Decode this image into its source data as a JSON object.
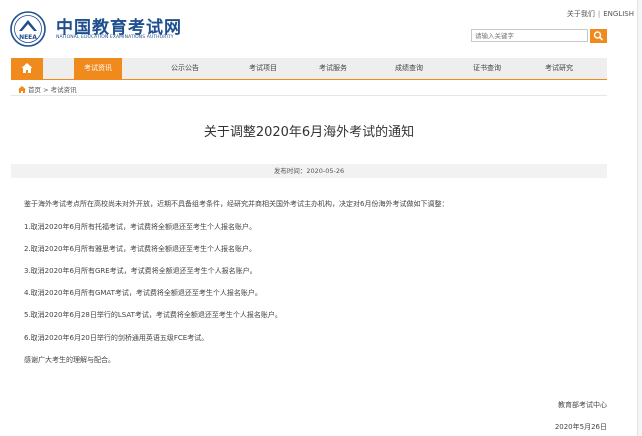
{
  "header": {
    "logo_title": "中国教育考试网",
    "logo_subtitle": "NATIONAL EDUCATION EXAMINATIONS AUTHORITY",
    "logo_mark_text": "NEEA",
    "top_links": [
      "关于我们",
      "ENGLISH"
    ],
    "top_link_separator": "|",
    "search_placeholder": "请输入关键字",
    "search_icon": "search-icon",
    "accent_color": "#f08a1d",
    "brand_color": "#1e4f8f"
  },
  "nav": {
    "home_icon": "home-icon",
    "items": [
      {
        "label": "考试资讯",
        "active": true
      },
      {
        "label": "公示公告",
        "active": false
      },
      {
        "label": "考试项目",
        "active": false
      },
      {
        "label": "考试服务",
        "active": false
      },
      {
        "label": "成绩查询",
        "active": false
      },
      {
        "label": "证书查询",
        "active": false
      },
      {
        "label": "考试研究",
        "active": false
      }
    ]
  },
  "breadcrumb": {
    "icon": "home-icon",
    "home": "首页",
    "separator": ">",
    "current": "考试资讯"
  },
  "article": {
    "title": "关于调整2020年6月海外考试的通知",
    "publish_label": "发布时间：",
    "publish_date": "2020-05-26",
    "paragraphs": [
      "鉴于海外考试考点所在高校尚未对外开放，近期不具备组考条件，经研究并商相关国外考试主办机构，决定对6月份海外考试做如下调整：",
      "1.取消2020年6月所有托福考试，考试费将全额退还至考生个人报名账户。",
      "2.取消2020年6月所有雅思考试，考试费将全额退还至考生个人报名账户。",
      "3.取消2020年6月所有GRE考试，考试费将全额退还至考生个人报名账户。",
      "4.取消2020年6月所有GMAT考试，考试费将全额退还至考生个人报名账户。",
      "5.取消2020年6月28日举行的LSAT考试，考试费将全额退还至考生个人报名账户。",
      "6.取消2020年6月20日举行的剑桥通用英语五级FCE考试。",
      "感谢广大考生的理解与配合。"
    ],
    "sign_org": "教育部考试中心",
    "sign_date": "2020年5月26日"
  }
}
